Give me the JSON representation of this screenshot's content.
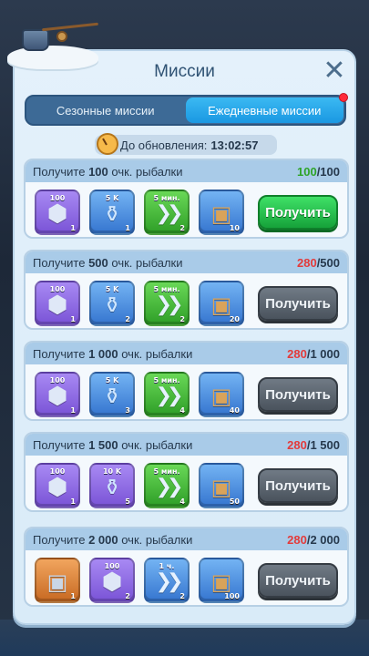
{
  "header": {
    "title": "Миссии"
  },
  "tabs": [
    {
      "label": "Сезонные миссии",
      "active": false
    },
    {
      "label": "Ежедневные миссии",
      "active": true
    }
  ],
  "timer": {
    "label": "До обновления:",
    "value": "13:02:57"
  },
  "missions": [
    {
      "prefix": "Получите ",
      "amount": "100",
      "suffix": " очк. рыбалки",
      "current": "100",
      "total": "/100",
      "complete": true,
      "claim_label": "Получить",
      "rewards": [
        {
          "type": "gear-icon",
          "top": "100",
          "count": "1"
        },
        {
          "type": "bottle-icon",
          "top": "5 K",
          "count": "1"
        },
        {
          "type": "speedup-icon",
          "top": "5 мин.",
          "count": "2"
        },
        {
          "type": "chest-icon",
          "top": "",
          "count": "10"
        }
      ]
    },
    {
      "prefix": "Получите ",
      "amount": "500",
      "suffix": " очк. рыбалки",
      "current": "280",
      "total": "/500",
      "complete": false,
      "claim_label": "Получить",
      "rewards": [
        {
          "type": "gear-icon",
          "top": "100",
          "count": "1"
        },
        {
          "type": "bottle-icon",
          "top": "5 K",
          "count": "2"
        },
        {
          "type": "speedup-icon",
          "top": "5 мин.",
          "count": "2"
        },
        {
          "type": "chest-icon",
          "top": "",
          "count": "20"
        }
      ]
    },
    {
      "prefix": "Получите ",
      "amount": "1 000",
      "suffix": " очк. рыбалки",
      "current": "280",
      "total": "/1 000",
      "complete": false,
      "claim_label": "Получить",
      "rewards": [
        {
          "type": "gear-icon",
          "top": "100",
          "count": "1"
        },
        {
          "type": "bottle-icon",
          "top": "5 K",
          "count": "3"
        },
        {
          "type": "speedup-icon",
          "top": "5 мин.",
          "count": "4"
        },
        {
          "type": "chest-icon",
          "top": "",
          "count": "40"
        }
      ]
    },
    {
      "prefix": "Получите ",
      "amount": "1 500",
      "suffix": " очк. рыбалки",
      "current": "280",
      "total": "/1 500",
      "complete": false,
      "claim_label": "Получить",
      "rewards": [
        {
          "type": "gear-icon",
          "top": "100",
          "count": "1"
        },
        {
          "type": "bottle-icon",
          "top": "10 K",
          "count": "5"
        },
        {
          "type": "speedup-icon",
          "top": "5 мин.",
          "count": "4"
        },
        {
          "type": "chest-icon",
          "top": "",
          "count": "50"
        }
      ]
    },
    {
      "prefix": "Получите ",
      "amount": "2 000",
      "suffix": " очк. рыбалки",
      "current": "280",
      "total": "/2 000",
      "complete": false,
      "claim_label": "Получить",
      "rewards": [
        {
          "type": "orange-chest-icon",
          "top": "",
          "count": "1"
        },
        {
          "type": "gear-icon",
          "top": "100",
          "count": "2"
        },
        {
          "type": "speedup-icon",
          "top": "1 ч.",
          "count": "2"
        },
        {
          "type": "chest-icon",
          "top": "",
          "count": "100"
        }
      ]
    }
  ],
  "colors": {
    "accent_tab": "#1a98e2",
    "progress_incomplete": "#e33b3b",
    "progress_complete": "#2fa428",
    "claim_active": "#16a23a",
    "claim_disabled": "#4a535d"
  }
}
